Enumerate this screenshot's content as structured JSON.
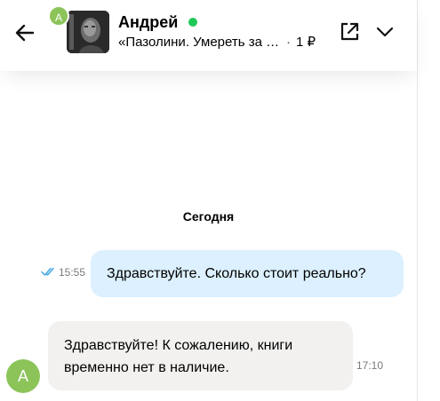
{
  "header": {
    "back_icon": "arrow-left-icon",
    "small_avatar_letter": "А",
    "user_name": "Андрей",
    "online": true,
    "online_color": "#1fc957",
    "item_title": "«Пазолини. Умереть за идеи»",
    "item_separator": "·",
    "item_price": "1 ₽",
    "open_icon": "external-link-icon",
    "collapse_icon": "chevron-down-icon"
  },
  "chat": {
    "day_divider": "Сегодня",
    "messages": [
      {
        "direction": "outgoing",
        "text": "Здравствуйте. Сколько стоит реально?",
        "time": "15:55",
        "status": "read",
        "status_icon": "double-check-icon",
        "bubble_color": "#dcf0ff"
      },
      {
        "direction": "incoming",
        "avatar_letter": "А",
        "text": "Здравствуйте! К сожалению, книги временно нет в наличие.",
        "time": "17:10",
        "bubble_color": "#f2f1f0"
      }
    ]
  },
  "colors": {
    "avatar_green": "#8cc45a",
    "read_check_blue": "#3aa3e3"
  }
}
